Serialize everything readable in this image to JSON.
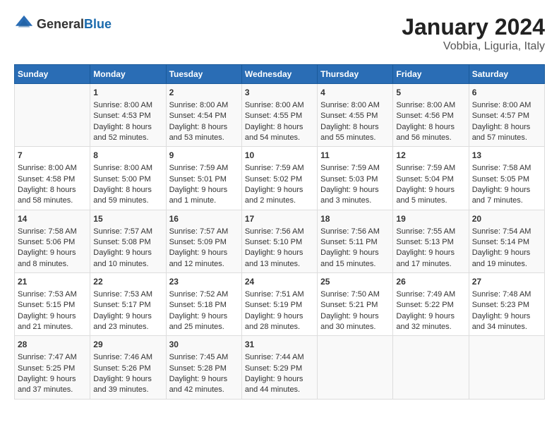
{
  "header": {
    "logo": {
      "general": "General",
      "blue": "Blue"
    },
    "title": "January 2024",
    "location": "Vobbia, Liguria, Italy"
  },
  "calendar": {
    "columns": [
      "Sunday",
      "Monday",
      "Tuesday",
      "Wednesday",
      "Thursday",
      "Friday",
      "Saturday"
    ],
    "weeks": [
      [
        {
          "day": "",
          "content": ""
        },
        {
          "day": "1",
          "content": "Sunrise: 8:00 AM\nSunset: 4:53 PM\nDaylight: 8 hours\nand 52 minutes."
        },
        {
          "day": "2",
          "content": "Sunrise: 8:00 AM\nSunset: 4:54 PM\nDaylight: 8 hours\nand 53 minutes."
        },
        {
          "day": "3",
          "content": "Sunrise: 8:00 AM\nSunset: 4:55 PM\nDaylight: 8 hours\nand 54 minutes."
        },
        {
          "day": "4",
          "content": "Sunrise: 8:00 AM\nSunset: 4:55 PM\nDaylight: 8 hours\nand 55 minutes."
        },
        {
          "day": "5",
          "content": "Sunrise: 8:00 AM\nSunset: 4:56 PM\nDaylight: 8 hours\nand 56 minutes."
        },
        {
          "day": "6",
          "content": "Sunrise: 8:00 AM\nSunset: 4:57 PM\nDaylight: 8 hours\nand 57 minutes."
        }
      ],
      [
        {
          "day": "7",
          "content": "Sunrise: 8:00 AM\nSunset: 4:58 PM\nDaylight: 8 hours\nand 58 minutes."
        },
        {
          "day": "8",
          "content": "Sunrise: 8:00 AM\nSunset: 5:00 PM\nDaylight: 8 hours\nand 59 minutes."
        },
        {
          "day": "9",
          "content": "Sunrise: 7:59 AM\nSunset: 5:01 PM\nDaylight: 9 hours\nand 1 minute."
        },
        {
          "day": "10",
          "content": "Sunrise: 7:59 AM\nSunset: 5:02 PM\nDaylight: 9 hours\nand 2 minutes."
        },
        {
          "day": "11",
          "content": "Sunrise: 7:59 AM\nSunset: 5:03 PM\nDaylight: 9 hours\nand 3 minutes."
        },
        {
          "day": "12",
          "content": "Sunrise: 7:59 AM\nSunset: 5:04 PM\nDaylight: 9 hours\nand 5 minutes."
        },
        {
          "day": "13",
          "content": "Sunrise: 7:58 AM\nSunset: 5:05 PM\nDaylight: 9 hours\nand 7 minutes."
        }
      ],
      [
        {
          "day": "14",
          "content": "Sunrise: 7:58 AM\nSunset: 5:06 PM\nDaylight: 9 hours\nand 8 minutes."
        },
        {
          "day": "15",
          "content": "Sunrise: 7:57 AM\nSunset: 5:08 PM\nDaylight: 9 hours\nand 10 minutes."
        },
        {
          "day": "16",
          "content": "Sunrise: 7:57 AM\nSunset: 5:09 PM\nDaylight: 9 hours\nand 12 minutes."
        },
        {
          "day": "17",
          "content": "Sunrise: 7:56 AM\nSunset: 5:10 PM\nDaylight: 9 hours\nand 13 minutes."
        },
        {
          "day": "18",
          "content": "Sunrise: 7:56 AM\nSunset: 5:11 PM\nDaylight: 9 hours\nand 15 minutes."
        },
        {
          "day": "19",
          "content": "Sunrise: 7:55 AM\nSunset: 5:13 PM\nDaylight: 9 hours\nand 17 minutes."
        },
        {
          "day": "20",
          "content": "Sunrise: 7:54 AM\nSunset: 5:14 PM\nDaylight: 9 hours\nand 19 minutes."
        }
      ],
      [
        {
          "day": "21",
          "content": "Sunrise: 7:53 AM\nSunset: 5:15 PM\nDaylight: 9 hours\nand 21 minutes."
        },
        {
          "day": "22",
          "content": "Sunrise: 7:53 AM\nSunset: 5:17 PM\nDaylight: 9 hours\nand 23 minutes."
        },
        {
          "day": "23",
          "content": "Sunrise: 7:52 AM\nSunset: 5:18 PM\nDaylight: 9 hours\nand 25 minutes."
        },
        {
          "day": "24",
          "content": "Sunrise: 7:51 AM\nSunset: 5:19 PM\nDaylight: 9 hours\nand 28 minutes."
        },
        {
          "day": "25",
          "content": "Sunrise: 7:50 AM\nSunset: 5:21 PM\nDaylight: 9 hours\nand 30 minutes."
        },
        {
          "day": "26",
          "content": "Sunrise: 7:49 AM\nSunset: 5:22 PM\nDaylight: 9 hours\nand 32 minutes."
        },
        {
          "day": "27",
          "content": "Sunrise: 7:48 AM\nSunset: 5:23 PM\nDaylight: 9 hours\nand 34 minutes."
        }
      ],
      [
        {
          "day": "28",
          "content": "Sunrise: 7:47 AM\nSunset: 5:25 PM\nDaylight: 9 hours\nand 37 minutes."
        },
        {
          "day": "29",
          "content": "Sunrise: 7:46 AM\nSunset: 5:26 PM\nDaylight: 9 hours\nand 39 minutes."
        },
        {
          "day": "30",
          "content": "Sunrise: 7:45 AM\nSunset: 5:28 PM\nDaylight: 9 hours\nand 42 minutes."
        },
        {
          "day": "31",
          "content": "Sunrise: 7:44 AM\nSunset: 5:29 PM\nDaylight: 9 hours\nand 44 minutes."
        },
        {
          "day": "",
          "content": ""
        },
        {
          "day": "",
          "content": ""
        },
        {
          "day": "",
          "content": ""
        }
      ]
    ]
  }
}
